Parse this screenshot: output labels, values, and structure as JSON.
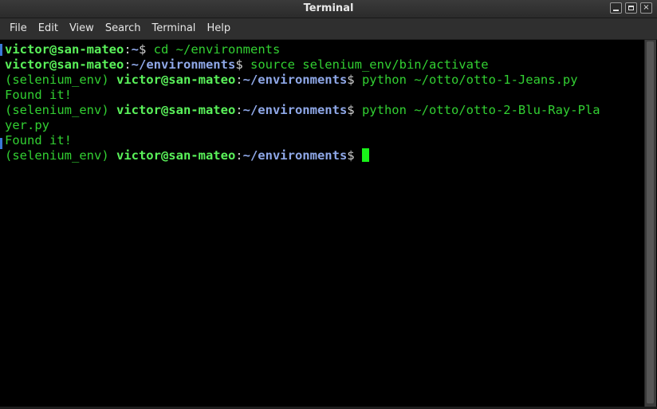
{
  "window": {
    "title": "Terminal",
    "controls": {
      "minimize": "minimize",
      "maximize": "maximize",
      "close": "×"
    }
  },
  "menu": {
    "items": [
      "File",
      "Edit",
      "View",
      "Search",
      "Terminal",
      "Help"
    ]
  },
  "terminal": {
    "lines": [
      {
        "venv": "",
        "user": "victor@san-mateo",
        "sep": ":",
        "path": "~",
        "prompt": "$ ",
        "cmd": "cd ~/environments"
      },
      {
        "venv": "",
        "user": "victor@san-mateo",
        "sep": ":",
        "path": "~/environments",
        "prompt": "$ ",
        "cmd": "source selenium_env/bin/activate"
      },
      {
        "venv": "(selenium_env) ",
        "user": "victor@san-mateo",
        "sep": ":",
        "path": "~/environments",
        "prompt": "$ ",
        "cmd": "python ~/otto/otto-1-Jeans.py"
      },
      {
        "output": "Found it!"
      },
      {
        "venv": "(selenium_env) ",
        "user": "victor@san-mateo",
        "sep": ":",
        "path": "~/environments",
        "prompt": "$ ",
        "cmd": "python ~/otto/otto-2-Blu-Ray-Pla"
      },
      {
        "output": "yer.py"
      },
      {
        "output": "Found it!"
      },
      {
        "venv": "(selenium_env) ",
        "user": "victor@san-mateo",
        "sep": ":",
        "path": "~/environments",
        "prompt": "$ ",
        "cmd": ""
      }
    ]
  },
  "colors": {
    "background": "#000000",
    "prompt_user": "#5af25a",
    "prompt_path": "#8fa8e8",
    "text_green": "#32d032",
    "cursor": "#19f219"
  },
  "icons": {
    "minimize": "minimize-icon",
    "maximize": "maximize-icon",
    "close": "close-icon"
  }
}
